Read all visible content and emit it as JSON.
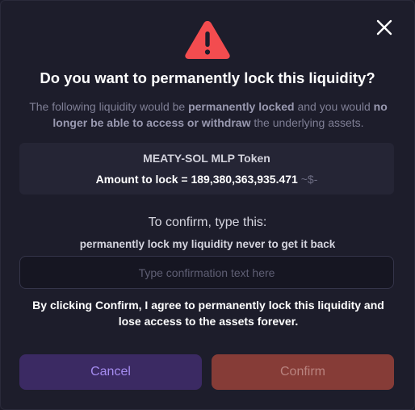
{
  "dialog": {
    "title": "Do you want to permanently lock this liquidity?",
    "description": {
      "part1": "The following liquidity would be ",
      "bold1": "permanently locked",
      "part2": " and you would ",
      "bold2": "no longer be able to access or withdraw",
      "part3": " the underlying assets."
    },
    "token": {
      "name": "MEATY-SOL MLP Token",
      "amount_label": "Amount to lock = ",
      "amount_value": "189,380,363,935.471",
      "amount_usd": "~$-"
    },
    "confirm": {
      "heading": "To confirm, type this:",
      "phrase": "permanently lock my liquidity never to get it back",
      "input_value": "",
      "input_placeholder": "Type confirmation text here"
    },
    "agreement": "By clicking Confirm, I agree to permanently lock this liquidity and lose access to the assets forever.",
    "buttons": {
      "cancel": "Cancel",
      "confirm": "Confirm"
    }
  },
  "icons": {
    "close": "close-icon",
    "warning": "warning-triangle-icon"
  },
  "colors": {
    "warning": "#f34c4f",
    "cancel_bg": "#3b2a63",
    "confirm_bg": "#863c37"
  }
}
